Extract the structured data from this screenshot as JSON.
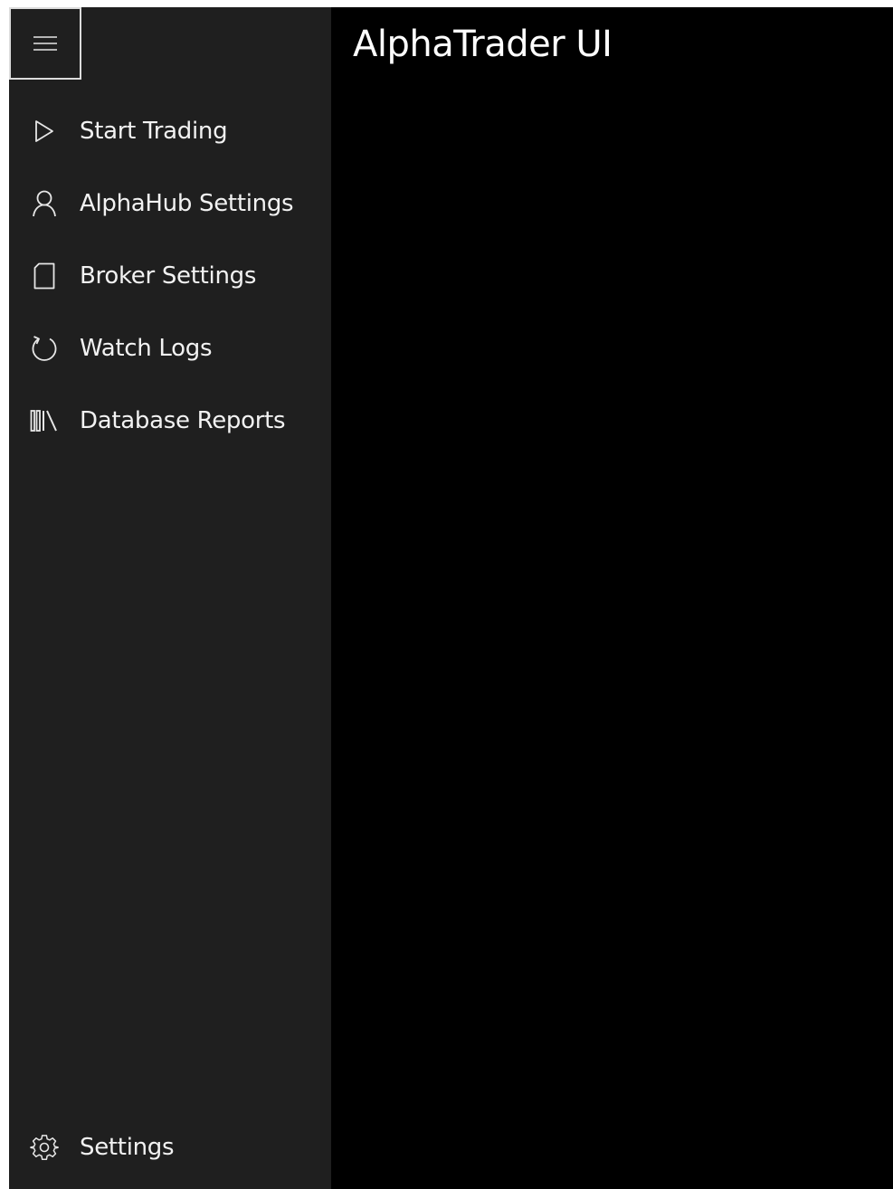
{
  "app": {
    "title": "AlphaTrader UI"
  },
  "sidebar": {
    "menu_icon": "hamburger-icon",
    "items": [
      {
        "label": "Start Trading",
        "icon": "play-icon"
      },
      {
        "label": "AlphaHub Settings",
        "icon": "person-icon"
      },
      {
        "label": "Broker Settings",
        "icon": "page-icon"
      },
      {
        "label": "Watch Logs",
        "icon": "refresh-icon"
      },
      {
        "label": "Database Reports",
        "icon": "library-icon"
      }
    ],
    "settings": {
      "label": "Settings",
      "icon": "gear-icon"
    }
  },
  "colors": {
    "sidebar_bg": "#1f1f1f",
    "content_bg": "#000000",
    "text": "#f2f2f2"
  }
}
